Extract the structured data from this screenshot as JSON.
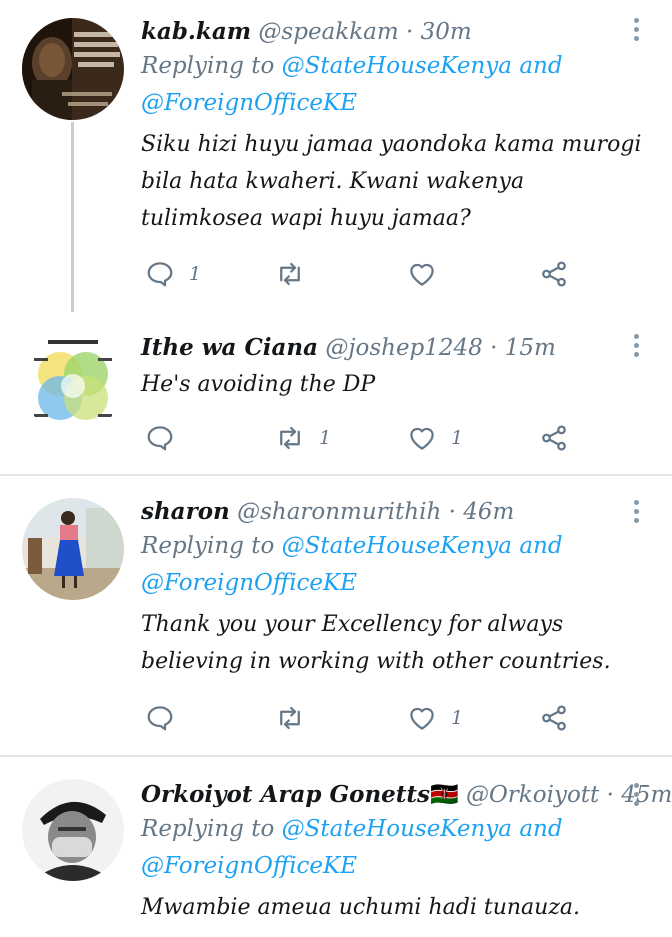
{
  "colors": {
    "accent": "#1da1f2",
    "muted": "#657786",
    "icon": "#657786",
    "divider": "#e1e8ed"
  },
  "tweets": [
    {
      "name": "kab.kam",
      "handle": "@speakkam",
      "dot": "·",
      "time": "30m",
      "replying_prefix": "Replying to",
      "mention1": "@StateHouseKenya",
      "and": "and",
      "mention2": "@ForeignOfficeKE",
      "text": "Siku hizi huyu jamaa yaondoka kama murogi bila hata kwaheri. Kwani wakenya tulimkosea wapi huyu jamaa?",
      "replies": "1",
      "retweets": "",
      "likes": "",
      "avatar_icon": "mlk-quote-avatar-icon"
    },
    {
      "name": "Ithe wa Ciana",
      "handle": "@joshep1248",
      "dot": "·",
      "time": "15m",
      "text": "He's avoiding the DP",
      "replies": "",
      "retweets": "1",
      "likes": "1",
      "avatar_icon": "venn-diagram-avatar-icon"
    },
    {
      "name": "sharon",
      "handle": "@sharonmurithih",
      "dot": "·",
      "time": "46m",
      "replying_prefix": "Replying to",
      "mention1": "@StateHouseKenya",
      "and": "and",
      "mention2": "@ForeignOfficeKE",
      "text": "Thank you your Excellency for always  believing in working with other countries.",
      "replies": "",
      "retweets": "",
      "likes": "1",
      "avatar_icon": "woman-blue-dress-avatar-icon"
    },
    {
      "name": "Orkoiyot Arap Gonetts",
      "flag": "🇰🇪",
      "handle": "@Orkoiyott",
      "dot": "·",
      "time": "45m",
      "replying_prefix": "Replying to",
      "mention1": "@StateHouseKenya",
      "and": "and",
      "mention2": "@ForeignOfficeKE",
      "text": "Mwambie ameua uchumi hadi tunauza.",
      "avatar_icon": "masked-man-avatar-icon"
    }
  ]
}
